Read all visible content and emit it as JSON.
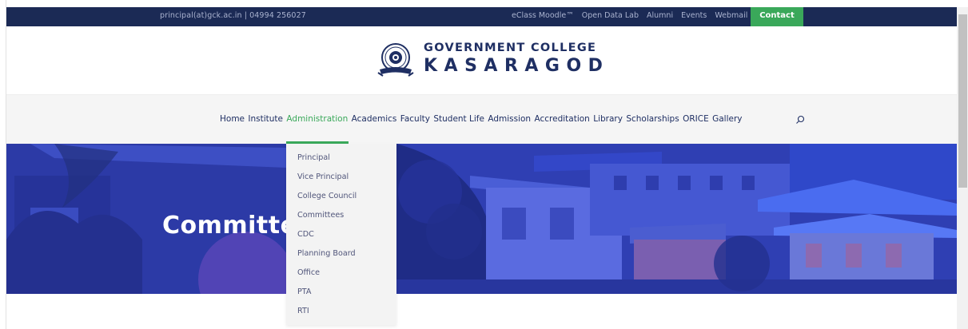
{
  "topbar": {
    "contact_info": "principal(at)gck.ac.in | 04994 256027",
    "links": [
      "eClass Moodle™",
      "Open Data Lab",
      "Alumni",
      "Events",
      "Webmail"
    ],
    "contact_button": "Contact"
  },
  "logo": {
    "line1": "GOVERNMENT COLLEGE",
    "line2": "KASARAGOD"
  },
  "nav": {
    "items": [
      "Home",
      "Institute",
      "Administration",
      "Academics",
      "Faculty",
      "Student Life",
      "Admission",
      "Accreditation",
      "Library",
      "Scholarships",
      "ORICE",
      "Gallery"
    ],
    "active": "Administration",
    "search_icon": "search-icon"
  },
  "hero": {
    "title": "Committe"
  },
  "dropdown": {
    "items": [
      "Principal",
      "Vice Principal",
      "College Council",
      "Committees",
      "CDC",
      "Planning Board",
      "Office",
      "PTA",
      "RTI"
    ]
  },
  "colors": {
    "topbar_bg": "#1b2a55",
    "accent_green": "#3aa85a",
    "brand_navy": "#1f2f63",
    "hero_overlay": "#2f3fb3"
  }
}
